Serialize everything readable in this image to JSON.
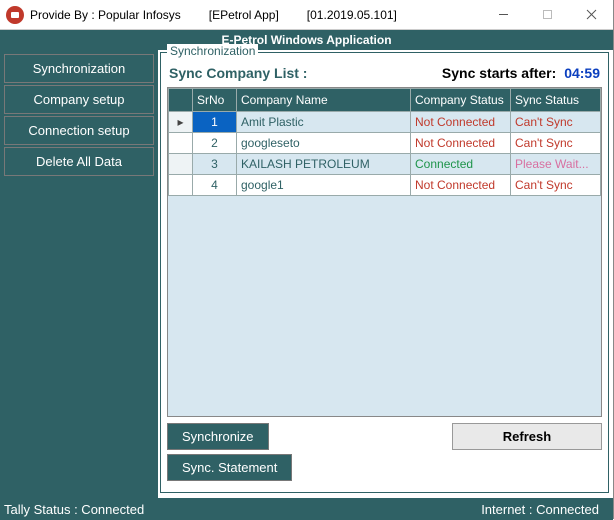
{
  "titlebar": {
    "provider": "Provide By : Popular Infosys",
    "app": "[EPetrol App]",
    "version": "[01.2019.05.101]"
  },
  "app_header": "E-Petrol Windows Application",
  "sidebar": {
    "items": [
      {
        "label": "Synchronization"
      },
      {
        "label": "Company setup"
      },
      {
        "label": "Connection setup"
      },
      {
        "label": "Delete All Data"
      }
    ]
  },
  "group": {
    "legend": "Synchronization",
    "list_title": "Sync Company List :",
    "sync_label": "Sync starts after:",
    "timer": "04:59",
    "columns": {
      "sr": "SrNo",
      "name": "Company Name",
      "cstatus": "Company Status",
      "sstatus": "Sync Status"
    },
    "rows": [
      {
        "sr": "1",
        "name": "Amit Plastic",
        "cstatus": "Not Connected",
        "ok": false,
        "sstatus": "Can't Sync",
        "wait": false,
        "sel": true
      },
      {
        "sr": "2",
        "name": "googleseto",
        "cstatus": "Not Connected",
        "ok": false,
        "sstatus": "Can't Sync",
        "wait": false,
        "sel": false
      },
      {
        "sr": "3",
        "name": "KAILASH PETROLEUM",
        "cstatus": "Connected",
        "ok": true,
        "sstatus": "Please Wait...",
        "wait": true,
        "sel": false
      },
      {
        "sr": "4",
        "name": "google1",
        "cstatus": "Not Connected",
        "ok": false,
        "sstatus": "Can't Sync",
        "wait": false,
        "sel": false
      }
    ],
    "buttons": {
      "sync": "Synchronize",
      "stmt": "Sync. Statement",
      "refresh": "Refresh"
    }
  },
  "statusbar": {
    "tally": "Tally Status : Connected",
    "internet": "Internet : Connected"
  }
}
